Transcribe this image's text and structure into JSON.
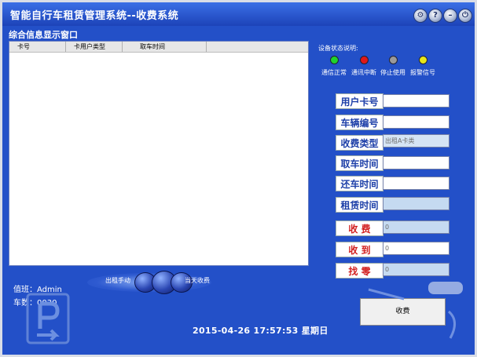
{
  "app": {
    "title": "智能自行车租赁管理系统--收费系统"
  },
  "window_controls": {
    "settings_glyph": "⚙",
    "help_glyph": "?",
    "minimize_glyph": "–",
    "power_glyph": "⏻"
  },
  "panel": {
    "title": "综合信息显示窗口",
    "columns": [
      "卡号",
      "卡用户类型",
      "取车时间"
    ]
  },
  "status": {
    "title": "设备状态说明:",
    "items": [
      {
        "label": "通信正常",
        "color": "#1fd22c"
      },
      {
        "label": "通讯中断",
        "color": "#e01818"
      },
      {
        "label": "停止使用",
        "color": "#9a9a9a"
      },
      {
        "label": "报警信号",
        "color": "#e6e619"
      }
    ]
  },
  "fields": [
    {
      "label": "用户卡号",
      "value": ""
    },
    {
      "label": "车辆编号",
      "value": ""
    },
    {
      "label": "收费类型",
      "value": "出租A卡类"
    },
    {
      "label": "取车时间",
      "value": ""
    },
    {
      "label": "还车时间",
      "value": ""
    },
    {
      "label": "租赁时间",
      "value": ""
    },
    {
      "label": "收  费",
      "value": "0"
    },
    {
      "label": "收  到",
      "value": "0"
    },
    {
      "label": "找  零",
      "value": "0"
    }
  ],
  "actions": {
    "fee_button": "收费"
  },
  "footer": {
    "duty": "值班：Admin",
    "car_count": "车数：0030",
    "mode_left": "出租手动",
    "mode_right": "当天收费",
    "datetime": "2015-04-26 17:57:53 星期日"
  }
}
